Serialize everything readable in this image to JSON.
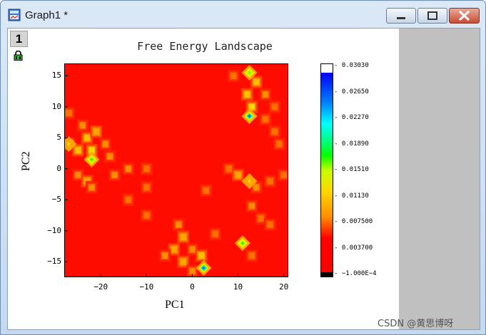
{
  "window": {
    "title": "Graph1 *",
    "layer_number": "1"
  },
  "chart_data": {
    "type": "heatmap",
    "title": "Free Energy Landscape",
    "xlabel": "PC1",
    "ylabel": "PC2",
    "xlim": [
      -28,
      21
    ],
    "ylim": [
      -17.5,
      17
    ],
    "xticks": [
      "−20",
      "−10",
      "0",
      "10",
      "20"
    ],
    "yticks": [
      "15",
      "10",
      "5",
      "0",
      "−5",
      "−10",
      "−15"
    ],
    "colorbar_ticks": [
      "0.03030",
      "0.02650",
      "0.02270",
      "0.01890",
      "0.01510",
      "0.01130",
      "0.007500",
      "0.003700",
      "−1.000E−4"
    ],
    "colorbar_range": [
      -0.0001,
      0.0303
    ],
    "background_value": 0.0015,
    "hotspots": [
      {
        "x": 12.5,
        "y": 8.5,
        "value": 0.026
      },
      {
        "x": 2.5,
        "y": -16,
        "value": 0.025
      },
      {
        "x": -22,
        "y": 1.5,
        "value": 0.017
      },
      {
        "x": 11,
        "y": -12,
        "value": 0.017
      },
      {
        "x": 12.5,
        "y": 15.5,
        "value": 0.016
      },
      {
        "x": 12.5,
        "y": -2,
        "value": 0.013
      },
      {
        "x": -27,
        "y": 4,
        "value": 0.012
      }
    ],
    "patches": [
      {
        "x": -27,
        "y": 4,
        "value": 0.012
      },
      {
        "x": -25,
        "y": 3,
        "value": 0.011
      },
      {
        "x": -23,
        "y": 5,
        "value": 0.011
      },
      {
        "x": -22,
        "y": 3,
        "value": 0.012
      },
      {
        "x": -21,
        "y": 6,
        "value": 0.01
      },
      {
        "x": -19,
        "y": 4,
        "value": 0.009
      },
      {
        "x": -24,
        "y": 7,
        "value": 0.009
      },
      {
        "x": -27,
        "y": 9,
        "value": 0.008
      },
      {
        "x": -18,
        "y": 2,
        "value": 0.009
      },
      {
        "x": -25,
        "y": -1,
        "value": 0.009
      },
      {
        "x": -23,
        "y": -2,
        "value": 0.01
      },
      {
        "x": -22,
        "y": -3,
        "value": 0.009
      },
      {
        "x": -17,
        "y": -1,
        "value": 0.009
      },
      {
        "x": -14,
        "y": 0,
        "value": 0.009
      },
      {
        "x": -10,
        "y": 0,
        "value": 0.008
      },
      {
        "x": -10,
        "y": -3,
        "value": 0.008
      },
      {
        "x": -14,
        "y": -5,
        "value": 0.008
      },
      {
        "x": -10,
        "y": -7.5,
        "value": 0.008
      },
      {
        "x": 14,
        "y": 14,
        "value": 0.011
      },
      {
        "x": 12,
        "y": 12,
        "value": 0.011
      },
      {
        "x": 16,
        "y": 12,
        "value": 0.009
      },
      {
        "x": 9,
        "y": 15,
        "value": 0.008
      },
      {
        "x": 18,
        "y": 10,
        "value": 0.008
      },
      {
        "x": 18,
        "y": 6,
        "value": 0.008
      },
      {
        "x": 13,
        "y": 10,
        "value": 0.012
      },
      {
        "x": 16,
        "y": 8,
        "value": 0.008
      },
      {
        "x": 19,
        "y": 4,
        "value": 0.008
      },
      {
        "x": 3,
        "y": -3.5,
        "value": 0.008
      },
      {
        "x": 8,
        "y": 0,
        "value": 0.008
      },
      {
        "x": 10,
        "y": -1,
        "value": 0.01
      },
      {
        "x": 14,
        "y": -3,
        "value": 0.009
      },
      {
        "x": 17,
        "y": -2,
        "value": 0.008
      },
      {
        "x": 20,
        "y": -1,
        "value": 0.008
      },
      {
        "x": 13,
        "y": -6,
        "value": 0.009
      },
      {
        "x": 15,
        "y": -8,
        "value": 0.008
      },
      {
        "x": 17,
        "y": -9,
        "value": 0.008
      },
      {
        "x": 5,
        "y": -10.5,
        "value": 0.008
      },
      {
        "x": -3,
        "y": -9,
        "value": 0.009
      },
      {
        "x": -2,
        "y": -11,
        "value": 0.01
      },
      {
        "x": 0,
        "y": -13,
        "value": 0.009
      },
      {
        "x": -4,
        "y": -13,
        "value": 0.01
      },
      {
        "x": -6,
        "y": -14,
        "value": 0.009
      },
      {
        "x": -2,
        "y": -15,
        "value": 0.01
      },
      {
        "x": 0,
        "y": -16.5,
        "value": 0.009
      },
      {
        "x": 2,
        "y": -14,
        "value": 0.011
      },
      {
        "x": 13,
        "y": -14,
        "value": 0.008
      }
    ]
  },
  "watermark": "CSDN @黄思博呀"
}
